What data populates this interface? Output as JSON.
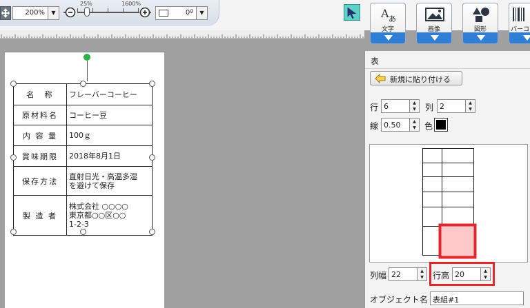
{
  "toolbar": {
    "zoom_value": "200%",
    "zoom_min_label": "25%",
    "zoom_max_label": "1600%",
    "rotation_value": "0º",
    "tools": [
      {
        "label": "文字",
        "icon": "text-tool-icon"
      },
      {
        "label": "画像",
        "icon": "image-tool-icon"
      },
      {
        "label": "図形",
        "icon": "shape-tool-icon"
      },
      {
        "label": "バーコ",
        "icon": "barcode-tool-icon"
      }
    ],
    "accent_color": "#2f7fd6",
    "select_tool_color": "#5ed2c8"
  },
  "label": {
    "rows": [
      {
        "key": "名　称",
        "value": "フレーバーコーヒー"
      },
      {
        "key": "原材料名",
        "value": "コーヒー豆"
      },
      {
        "key": "内 容 量",
        "value": "100ｇ"
      },
      {
        "key": "賞味期限",
        "value": "2018年8月1日"
      },
      {
        "key": "保存方法",
        "value": "直射日光・高温多湿\nを避けて保存"
      },
      {
        "key": "製 造 者",
        "value": "株式会社 ○○○○\n東京都○○区○○\n1-2-3"
      }
    ]
  },
  "panel": {
    "title": "表",
    "paste_button": "新規に貼り付ける",
    "rows_label": "行",
    "rows_value": "6",
    "cols_label": "列",
    "cols_value": "2",
    "line_label": "線",
    "line_value": "0.50",
    "color_label": "色",
    "line_color": "#000000",
    "col_width_label": "列幅",
    "col_width_value": "22",
    "row_height_label": "行高",
    "row_height_value": "20",
    "object_name_label": "オブジェクト名",
    "object_name_value": "表組#1",
    "highlight_color": "#e3262e",
    "selected_cell_color": "#ffc9c9"
  }
}
